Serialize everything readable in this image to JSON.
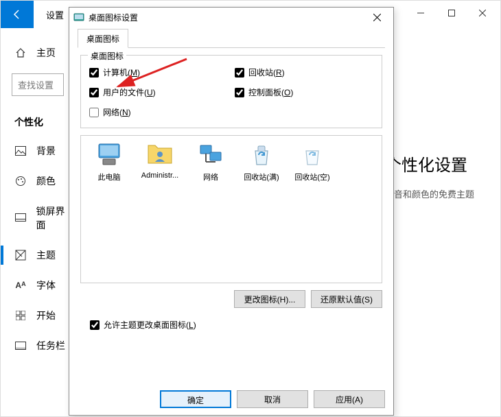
{
  "bg": {
    "title": "设置",
    "home": "主页",
    "search_placeholder": "查找设置",
    "section": "个性化",
    "nav": [
      "背景",
      "颜色",
      "锁屏界面",
      "主题",
      "字体",
      "开始",
      "任务栏"
    ],
    "right_title": "个性化设置",
    "right_sub": "声音和颜色的免费主题"
  },
  "dlg": {
    "title": "桌面图标设置",
    "tab": "桌面图标",
    "group_title": "桌面图标",
    "checks": {
      "computer": {
        "pre": "计算机(",
        "u": "M",
        "post": ")"
      },
      "recycle": {
        "pre": "回收站(",
        "u": "R",
        "post": ")"
      },
      "userdocs": {
        "pre": "用户的文件(",
        "u": "U",
        "post": ")"
      },
      "cpanel": {
        "pre": "控制面板(",
        "u": "O",
        "post": ")"
      },
      "network": {
        "pre": "网络(",
        "u": "N",
        "post": ")"
      }
    },
    "icons": [
      "此电脑",
      "Administr...",
      "网络",
      "回收站(满)",
      "回收站(空)"
    ],
    "btn_change": "更改图标(H)...",
    "btn_restore": "还原默认值(S)",
    "allow_theme": {
      "pre": "允许主题更改桌面图标(",
      "u": "L",
      "post": ")"
    },
    "ok": "确定",
    "cancel": "取消",
    "apply": "应用(A)"
  }
}
